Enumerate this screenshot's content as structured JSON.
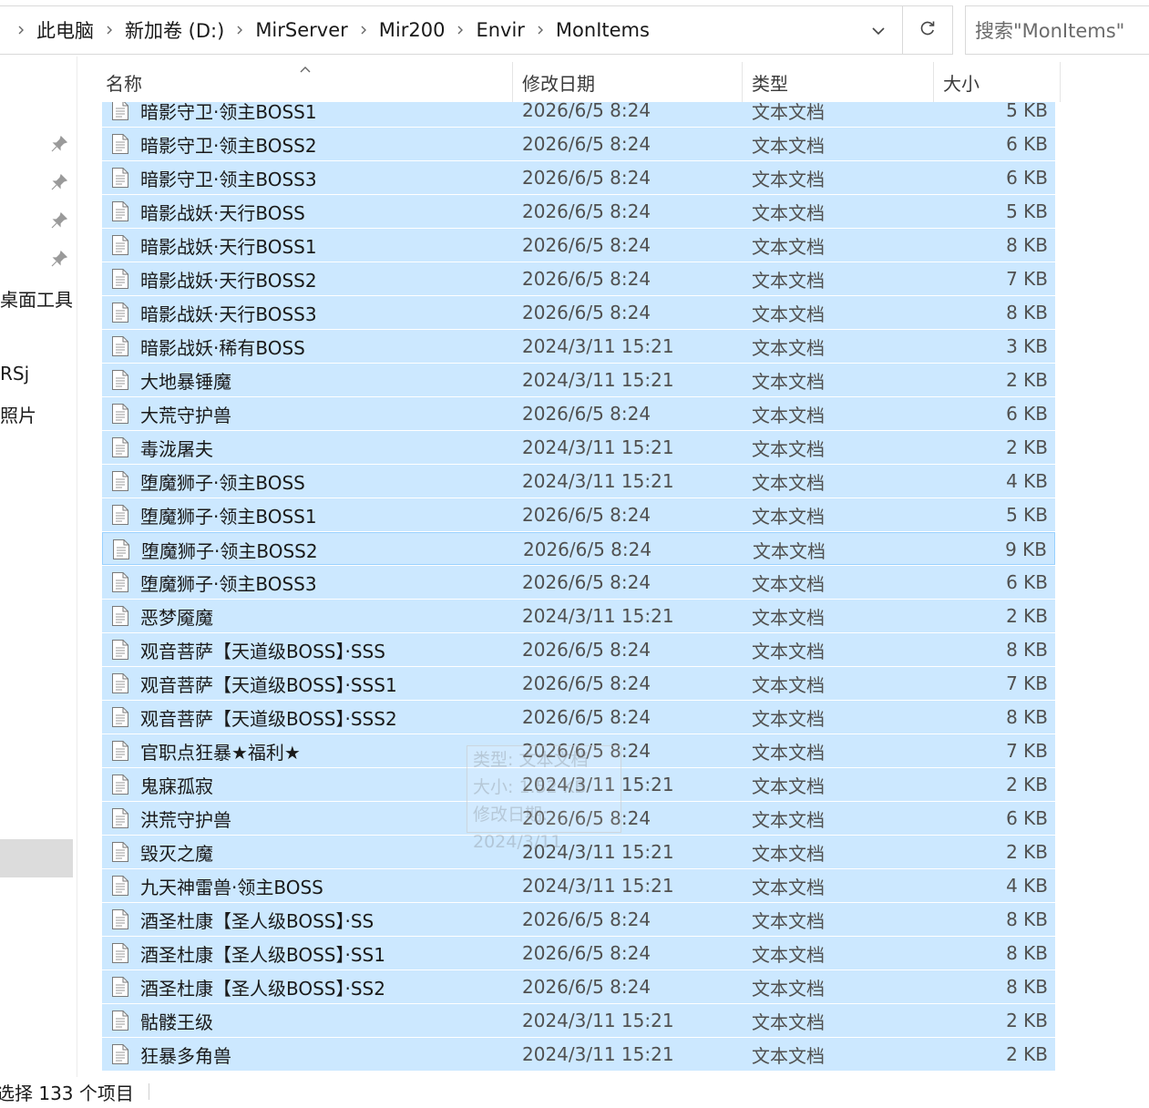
{
  "address": {
    "crumbs": [
      "此电脑",
      "新加卷 (D:)",
      "MirServer",
      "Mir200",
      "Envir",
      "MonItems"
    ]
  },
  "search": {
    "placeholder": "搜索\"MonItems\""
  },
  "nav": {
    "items": [
      "桌面工具",
      "RSj",
      "照片"
    ]
  },
  "columns": {
    "name": "名称",
    "date": "修改日期",
    "type": "类型",
    "size": "大小"
  },
  "files": [
    {
      "name": "暗影守卫·领主BOSS1",
      "date": "2026/6/5 8:24",
      "type": "文本文档",
      "size": "5 KB"
    },
    {
      "name": "暗影守卫·领主BOSS2",
      "date": "2026/6/5 8:24",
      "type": "文本文档",
      "size": "6 KB"
    },
    {
      "name": "暗影守卫·领主BOSS3",
      "date": "2026/6/5 8:24",
      "type": "文本文档",
      "size": "6 KB"
    },
    {
      "name": "暗影战妖·天行BOSS",
      "date": "2026/6/5 8:24",
      "type": "文本文档",
      "size": "5 KB"
    },
    {
      "name": "暗影战妖·天行BOSS1",
      "date": "2026/6/5 8:24",
      "type": "文本文档",
      "size": "8 KB"
    },
    {
      "name": "暗影战妖·天行BOSS2",
      "date": "2026/6/5 8:24",
      "type": "文本文档",
      "size": "7 KB"
    },
    {
      "name": "暗影战妖·天行BOSS3",
      "date": "2026/6/5 8:24",
      "type": "文本文档",
      "size": "8 KB"
    },
    {
      "name": "暗影战妖·稀有BOSS",
      "date": "2024/3/11 15:21",
      "type": "文本文档",
      "size": "3 KB"
    },
    {
      "name": "大地暴锤魔",
      "date": "2024/3/11 15:21",
      "type": "文本文档",
      "size": "2 KB"
    },
    {
      "name": "大荒守护兽",
      "date": "2026/6/5 8:24",
      "type": "文本文档",
      "size": "6 KB"
    },
    {
      "name": "毒泷屠夫",
      "date": "2024/3/11 15:21",
      "type": "文本文档",
      "size": "2 KB"
    },
    {
      "name": "堕魔狮子·领主BOSS",
      "date": "2024/3/11 15:21",
      "type": "文本文档",
      "size": "4 KB"
    },
    {
      "name": "堕魔狮子·领主BOSS1",
      "date": "2026/6/5 8:24",
      "type": "文本文档",
      "size": "5 KB"
    },
    {
      "name": "堕魔狮子·领主BOSS2",
      "date": "2026/6/5 8:24",
      "type": "文本文档",
      "size": "9 KB"
    },
    {
      "name": "堕魔狮子·领主BOSS3",
      "date": "2026/6/5 8:24",
      "type": "文本文档",
      "size": "6 KB"
    },
    {
      "name": "恶梦魇魔",
      "date": "2024/3/11 15:21",
      "type": "文本文档",
      "size": "2 KB"
    },
    {
      "name": "观音菩萨【天道级BOSS】·SSS",
      "date": "2026/6/5 8:24",
      "type": "文本文档",
      "size": "8 KB"
    },
    {
      "name": "观音菩萨【天道级BOSS】·SSS1",
      "date": "2026/6/5 8:24",
      "type": "文本文档",
      "size": "7 KB"
    },
    {
      "name": "观音菩萨【天道级BOSS】·SSS2",
      "date": "2026/6/5 8:24",
      "type": "文本文档",
      "size": "8 KB"
    },
    {
      "name": "官职点狂暴★福利★",
      "date": "2026/6/5 8:24",
      "type": "文本文档",
      "size": "7 KB"
    },
    {
      "name": "鬼寐孤寂",
      "date": "2024/3/11 15:21",
      "type": "文本文档",
      "size": "2 KB"
    },
    {
      "name": "洪荒守护兽",
      "date": "2026/6/5 8:24",
      "type": "文本文档",
      "size": "6 KB"
    },
    {
      "name": "毁灭之魔",
      "date": "2024/3/11 15:21",
      "type": "文本文档",
      "size": "2 KB"
    },
    {
      "name": "九天神雷兽·领主BOSS",
      "date": "2024/3/11 15:21",
      "type": "文本文档",
      "size": "4 KB"
    },
    {
      "name": "酒圣杜康【圣人级BOSS】·SS",
      "date": "2026/6/5 8:24",
      "type": "文本文档",
      "size": "8 KB"
    },
    {
      "name": "酒圣杜康【圣人级BOSS】·SS1",
      "date": "2026/6/5 8:24",
      "type": "文本文档",
      "size": "8 KB"
    },
    {
      "name": "酒圣杜康【圣人级BOSS】·SS2",
      "date": "2026/6/5 8:24",
      "type": "文本文档",
      "size": "8 KB"
    },
    {
      "name": "骷髅王级",
      "date": "2024/3/11 15:21",
      "type": "文本文档",
      "size": "2 KB"
    },
    {
      "name": "狂暴多角兽",
      "date": "2024/3/11 15:21",
      "type": "文本文档",
      "size": "2 KB"
    }
  ],
  "tooltip_ghost": {
    "lines": [
      "类型: 文本文档",
      "大小: 1.52 KB",
      "修改日期: 2024/3/11"
    ]
  },
  "status": {
    "text": "选择 133 个项目"
  },
  "colors": {
    "selection": "#cce8ff",
    "focus_border": "#99d1ff"
  }
}
